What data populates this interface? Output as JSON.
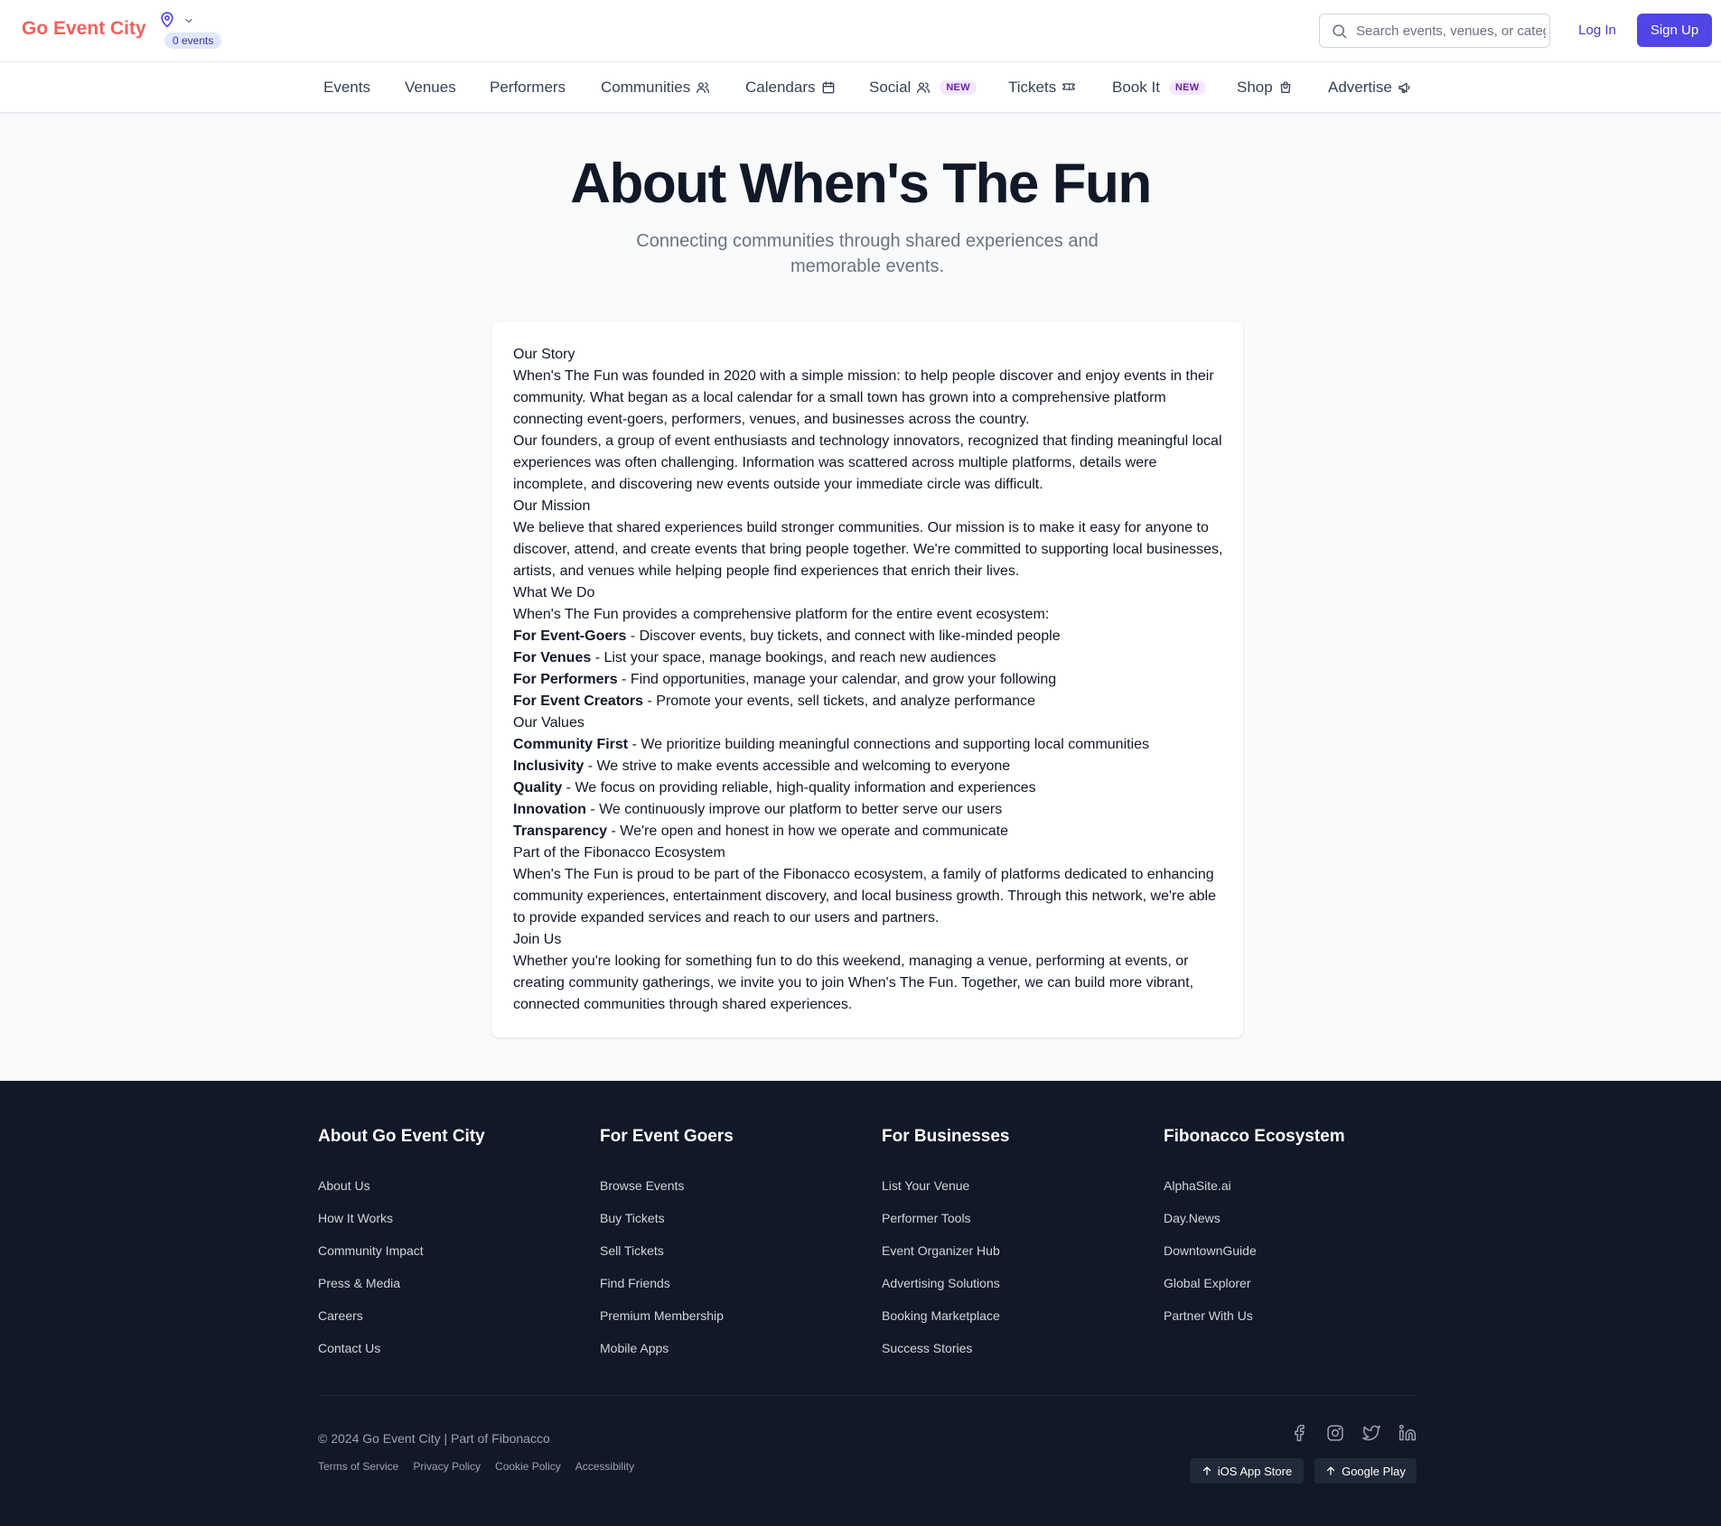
{
  "header": {
    "logo": "Go Event City",
    "events_badge": "0 events",
    "search_placeholder": "Search events, venues, or categories...",
    "login": "Log In",
    "signup": "Sign Up"
  },
  "nav": {
    "items": [
      {
        "label": "Events",
        "icon": ""
      },
      {
        "label": "Venues",
        "icon": ""
      },
      {
        "label": "Performers",
        "icon": ""
      },
      {
        "label": "Communities",
        "icon": "users-icon"
      },
      {
        "label": "Calendars",
        "icon": "calendar-icon"
      },
      {
        "label": "Social",
        "icon": "users-icon",
        "badge": "NEW"
      },
      {
        "label": "Tickets",
        "icon": "ticket-icon"
      },
      {
        "label": "Book It",
        "icon": "",
        "badge": "NEW"
      },
      {
        "label": "Shop",
        "icon": "shopping-bag-icon"
      },
      {
        "label": "Advertise",
        "icon": "megaphone-icon"
      }
    ]
  },
  "hero": {
    "title": "About When's The Fun",
    "subtitle": "Connecting communities through shared experiences and memorable events."
  },
  "about": {
    "story_heading": "Our Story",
    "story_p1": "When's The Fun was founded in 2020 with a simple mission: to help people discover and enjoy events in their community. What began as a local calendar for a small town has grown into a comprehensive platform connecting event-goers, performers, venues, and businesses across the country.",
    "story_p2": "Our founders, a group of event enthusiasts and technology innovators, recognized that finding meaningful local experiences was often challenging. Information was scattered across multiple platforms, details were incomplete, and discovering new events outside your immediate circle was difficult.",
    "mission_heading": "Our Mission",
    "mission_p": "We believe that shared experiences build stronger communities. Our mission is to make it easy for anyone to discover, attend, and create events that bring people together. We're committed to supporting local businesses, artists, and venues while helping people find experiences that enrich their lives.",
    "whatwedo_heading": "What We Do",
    "whatwedo_intro": "When's The Fun provides a comprehensive platform for the entire event ecosystem:",
    "whatwedo_items": [
      {
        "term": "For Event-Goers",
        "desc": " - Discover events, buy tickets, and connect with like-minded people"
      },
      {
        "term": "For Venues",
        "desc": " - List your space, manage bookings, and reach new audiences"
      },
      {
        "term": "For Performers",
        "desc": " - Find opportunities, manage your calendar, and grow your following"
      },
      {
        "term": "For Event Creators",
        "desc": " - Promote your events, sell tickets, and analyze performance"
      }
    ],
    "values_heading": "Our Values",
    "values_items": [
      {
        "term": "Community First",
        "desc": " - We prioritize building meaningful connections and supporting local communities"
      },
      {
        "term": "Inclusivity",
        "desc": " - We strive to make events accessible and welcoming to everyone"
      },
      {
        "term": "Quality",
        "desc": " - We focus on providing reliable, high-quality information and experiences"
      },
      {
        "term": "Innovation",
        "desc": " - We continuously improve our platform to better serve our users"
      },
      {
        "term": "Transparency",
        "desc": " - We're open and honest in how we operate and communicate"
      }
    ],
    "ecosystem_heading": "Part of the Fibonacco Ecosystem",
    "ecosystem_p": "When's The Fun is proud to be part of the Fibonacco ecosystem, a family of platforms dedicated to enhancing community experiences, entertainment discovery, and local business growth. Through this network, we're able to provide expanded services and reach to our users and partners.",
    "join_heading": "Join Us",
    "join_p": "Whether you're looking for something fun to do this weekend, managing a venue, performing at events, or creating community gatherings, we invite you to join When's The Fun. Together, we can build more vibrant, connected communities through shared experiences."
  },
  "footer": {
    "columns": [
      {
        "title": "About Go Event City",
        "links": [
          "About Us",
          "How It Works",
          "Community Impact",
          "Press & Media",
          "Careers",
          "Contact Us"
        ]
      },
      {
        "title": "For Event Goers",
        "links": [
          "Browse Events",
          "Buy Tickets",
          "Sell Tickets",
          "Find Friends",
          "Premium Membership",
          "Mobile Apps"
        ]
      },
      {
        "title": "For Businesses",
        "links": [
          "List Your Venue",
          "Performer Tools",
          "Event Organizer Hub",
          "Advertising Solutions",
          "Booking Marketplace",
          "Success Stories"
        ]
      },
      {
        "title": "Fibonacco Ecosystem",
        "links": [
          "AlphaSite.ai",
          "Day.News",
          "DowntownGuide",
          "Global Explorer",
          "Partner With Us"
        ]
      }
    ],
    "copyright": "© 2024 Go Event City | Part of Fibonacco",
    "legal": [
      "Terms of Service",
      "Privacy Policy",
      "Cookie Policy",
      "Accessibility"
    ],
    "social_icons": [
      "facebook-icon",
      "instagram-icon",
      "twitter-icon",
      "linkedin-icon"
    ],
    "ios": "iOS App Store",
    "android": "Google Play"
  },
  "colors": {
    "brand": "#f0615d",
    "accent": "#4f46e5",
    "footer_bg": "#111827"
  }
}
